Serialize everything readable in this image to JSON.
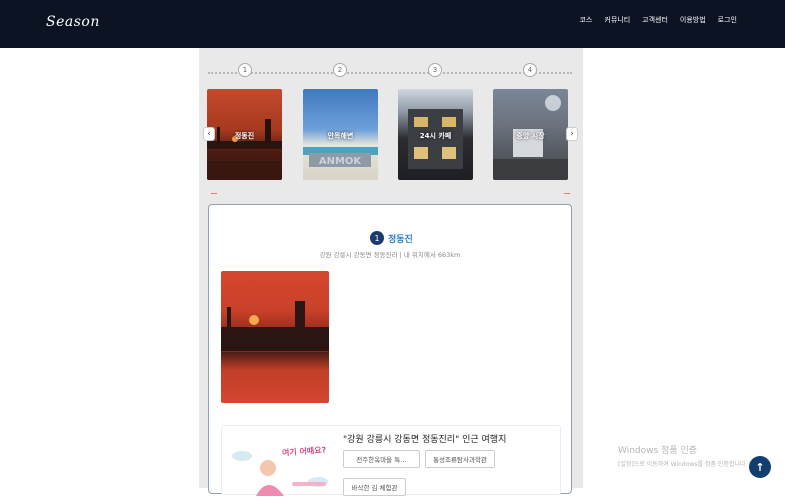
{
  "header": {
    "logo": "Season",
    "nav": [
      "코스",
      "커뮤니티",
      "고객센터",
      "이용방법",
      "로그인"
    ]
  },
  "steps": [
    "1",
    "2",
    "3",
    "4"
  ],
  "cards": [
    "정동진",
    "안목해변",
    "24시 카페",
    "중앙 시장"
  ],
  "arrows": {
    "prev": "‹",
    "next": "›"
  },
  "detail": {
    "number": "1",
    "title": "정동진",
    "subtitle": "강원 강릉시 강동면 정동진리 | 내 위치에서 663km"
  },
  "nearby": {
    "title": "\"강원 강릉시 강동면 정동진리\" 인근 여행지",
    "promo": "여기 어때요?",
    "chips": [
      "전주한옥마을 특…",
      "통성조류탐사과학관",
      "바삭한 김 체험관"
    ]
  },
  "watermark": {
    "line1": "Windows 정품 인증",
    "line2": "[설정]으로 이동하여 Windows를 정품 인증합니다."
  },
  "top_button": "↑"
}
